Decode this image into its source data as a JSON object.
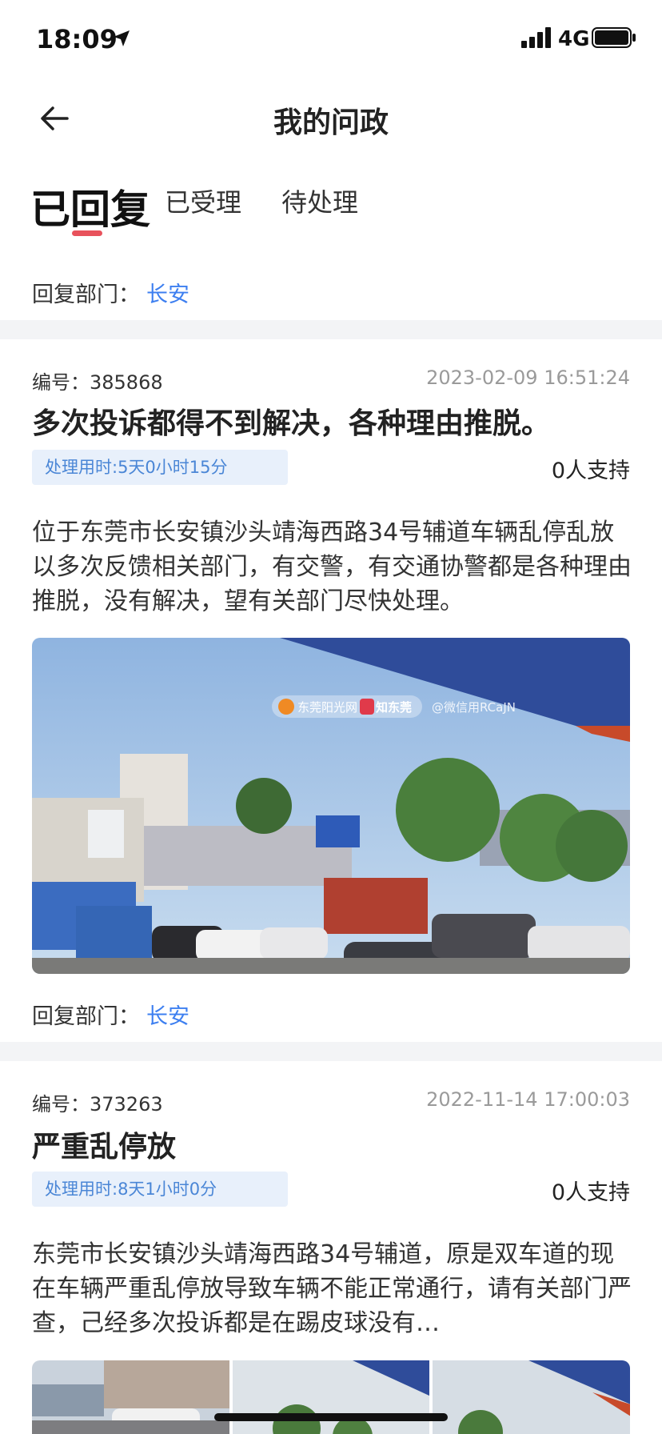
{
  "status_bar": {
    "time": "18:09",
    "network": "4G"
  },
  "nav": {
    "title": "我的问政"
  },
  "tabs": [
    {
      "label": "已回复",
      "active": true
    },
    {
      "label": "已受理",
      "active": false
    },
    {
      "label": "待处理",
      "active": false
    }
  ],
  "filter": {
    "label": "回复部门：",
    "value": "长安"
  },
  "posts": [
    {
      "id_label": "编号：",
      "id": "385868",
      "date": "2023-02-09 16:51:24",
      "title": "多次投诉都得不到解决，各种理由推脱。",
      "processing_time": "处理用时:5天0小时15分",
      "support": "0人支持",
      "body": "位于东莞市长安镇沙头靖海西路34号辅道车辆乱停乱放以多次反馈相关部门，有交警，有交通协警都是各种理由推脱，没有解决，望有关部门尽快处理。",
      "watermark": {
        "site": "东莞阳光网",
        "app": "知东莞",
        "user": "@微信用RCaJN"
      },
      "reply_dept_label": "回复部门：",
      "reply_dept": "长安"
    },
    {
      "id_label": "编号：",
      "id": "373263",
      "date": "2022-11-14 17:00:03",
      "title": "严重乱停放",
      "processing_time": "处理用时:8天1小时0分",
      "support": "0人支持",
      "body": "东莞市长安镇沙头靖海西路34号辅道，原是双车道的现在车辆严重乱停放导致车辆不能正常通行，请有关部门严查，己经多次投诉都是在踢皮球没有…"
    }
  ],
  "colors": {
    "accent": "#3d7ff0",
    "tab_indicator": "#e8525c",
    "chip_bg": "#e8f0fb"
  }
}
